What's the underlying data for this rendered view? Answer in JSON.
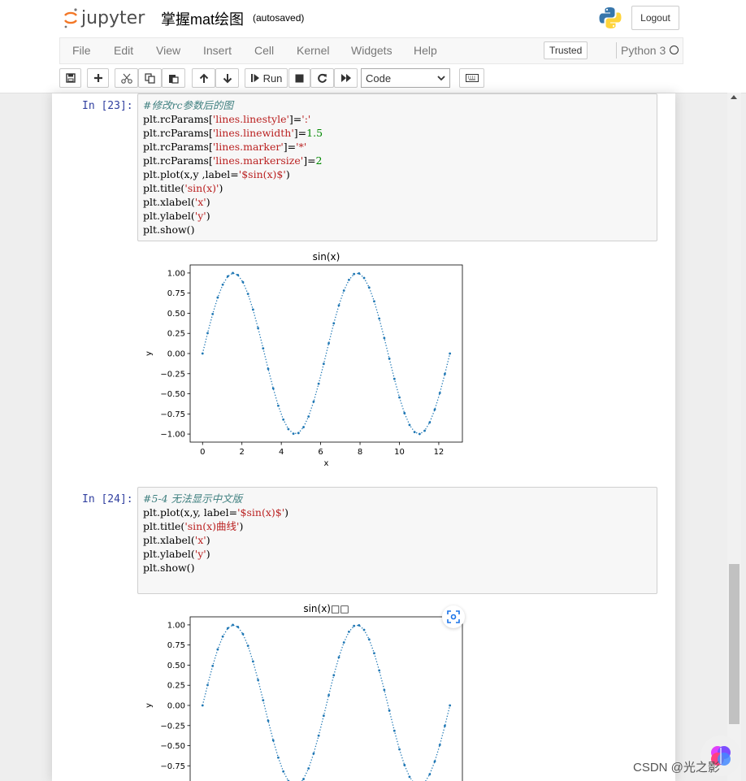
{
  "header": {
    "logo_text": "jupyter",
    "notebook_title": "掌握mat绘图",
    "autosave_status": "(autosaved)",
    "logout_label": "Logout"
  },
  "menu": {
    "items": [
      "File",
      "Edit",
      "View",
      "Insert",
      "Cell",
      "Kernel",
      "Widgets",
      "Help"
    ],
    "trusted_label": "Trusted",
    "kernel_name": "Python 3"
  },
  "toolbar": {
    "run_label": "Run",
    "cell_type": "Code"
  },
  "cells": [
    {
      "prompt": "In  [23]:",
      "lines": [
        [
          {
            "t": "#修改rc参数后的图",
            "c": "comment"
          }
        ],
        [
          {
            "t": "plt.rcParams["
          },
          {
            "t": "'lines.linestyle'",
            "c": "string"
          },
          {
            "t": "]="
          },
          {
            "t": "':'",
            "c": "string"
          }
        ],
        [
          {
            "t": "plt.rcParams["
          },
          {
            "t": "'lines.linewidth'",
            "c": "string"
          },
          {
            "t": "]="
          },
          {
            "t": "1.5",
            "c": "number"
          }
        ],
        [
          {
            "t": "plt.rcParams["
          },
          {
            "t": "'lines.marker'",
            "c": "string"
          },
          {
            "t": "]="
          },
          {
            "t": "'*'",
            "c": "string"
          }
        ],
        [
          {
            "t": "plt.rcParams["
          },
          {
            "t": "'lines.markersize'",
            "c": "string"
          },
          {
            "t": "]="
          },
          {
            "t": "2",
            "c": "number"
          }
        ],
        [
          {
            "t": "plt.plot(x,y ,label="
          },
          {
            "t": "'$sin(x)$'",
            "c": "string"
          },
          {
            "t": ")"
          }
        ],
        [
          {
            "t": "plt.title("
          },
          {
            "t": "'sin(x)'",
            "c": "string"
          },
          {
            "t": ")"
          }
        ],
        [
          {
            "t": "plt.xlabel("
          },
          {
            "t": "'x'",
            "c": "string"
          },
          {
            "t": ")"
          }
        ],
        [
          {
            "t": "plt.ylabel("
          },
          {
            "t": "'y'",
            "c": "string"
          },
          {
            "t": ")"
          }
        ],
        [
          {
            "t": "plt.show()"
          }
        ]
      ]
    },
    {
      "prompt": "In  [24]:",
      "lines": [
        [
          {
            "t": "#5-4 无法显示中文版",
            "c": "comment"
          }
        ],
        [
          {
            "t": "plt.plot(x,y, label="
          },
          {
            "t": "'$sin(x)$'",
            "c": "string"
          },
          {
            "t": ")"
          }
        ],
        [
          {
            "t": "plt.title("
          },
          {
            "t": "'sin(x)曲线'",
            "c": "string"
          },
          {
            "t": ")"
          }
        ],
        [
          {
            "t": "plt.xlabel("
          },
          {
            "t": "'x'",
            "c": "string"
          },
          {
            "t": ")"
          }
        ],
        [
          {
            "t": "plt.ylabel("
          },
          {
            "t": "'y'",
            "c": "string"
          },
          {
            "t": ")"
          }
        ],
        [
          {
            "t": "plt.show()"
          }
        ]
      ]
    }
  ],
  "chart_data": [
    {
      "type": "line",
      "title": "sin(x)",
      "xlabel": "x",
      "ylabel": "y",
      "function": "sin(x)",
      "x_range": [
        0,
        12.566
      ],
      "num_points": 50,
      "xlim": [
        -0.63,
        13.2
      ],
      "ylim": [
        -1.1,
        1.1
      ],
      "xticks": [
        0,
        2,
        4,
        6,
        8,
        10,
        12
      ],
      "yticks": [
        -1.0,
        -0.75,
        -0.5,
        -0.25,
        0.0,
        0.25,
        0.5,
        0.75,
        1.0
      ],
      "ytick_labels": [
        "−1.00",
        "−0.75",
        "−0.50",
        "−0.25",
        "0.00",
        "0.25",
        "0.50",
        "0.75",
        "1.00"
      ],
      "linestyle": "dotted",
      "marker": "*",
      "color": "#1f77b4"
    },
    {
      "type": "line",
      "title": "sin(x)□□",
      "xlabel": "",
      "ylabel": "y",
      "function": "sin(x)",
      "x_range": [
        0,
        12.566
      ],
      "num_points": 50,
      "xlim": [
        -0.63,
        13.2
      ],
      "ylim": [
        -1.1,
        1.1
      ],
      "xticks": [],
      "yticks": [
        -0.75,
        -0.5,
        -0.25,
        0.0,
        0.25,
        0.5,
        0.75,
        1.0
      ],
      "ytick_labels": [
        "−0.75",
        "−0.50",
        "−0.25",
        "0.00",
        "0.25",
        "0.50",
        "0.75",
        "1.00"
      ],
      "linestyle": "dotted",
      "marker": "*",
      "color": "#1f77b4"
    }
  ],
  "watermark": "CSDN @光之影"
}
